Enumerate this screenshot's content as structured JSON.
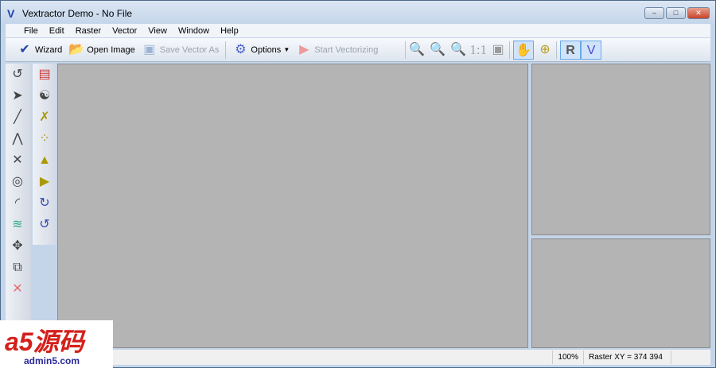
{
  "window": {
    "title": "Vextractor Demo - No File",
    "minimize": "–",
    "maximize": "□",
    "close": "✕"
  },
  "menu": [
    "File",
    "Edit",
    "Raster",
    "Vector",
    "View",
    "Window",
    "Help"
  ],
  "toolbar": {
    "wizard": "Wizard",
    "open_image": "Open Image",
    "save_vector_as": "Save Vector As",
    "options": "Options",
    "start_vectorizing": "Start Vectorizing",
    "zoom_1_1": "1:1"
  },
  "status": {
    "zoom": "100%",
    "raster_xy": "Raster XY =  374  394"
  },
  "watermark": {
    "logo": "a5源码",
    "url": "admin5.com"
  }
}
